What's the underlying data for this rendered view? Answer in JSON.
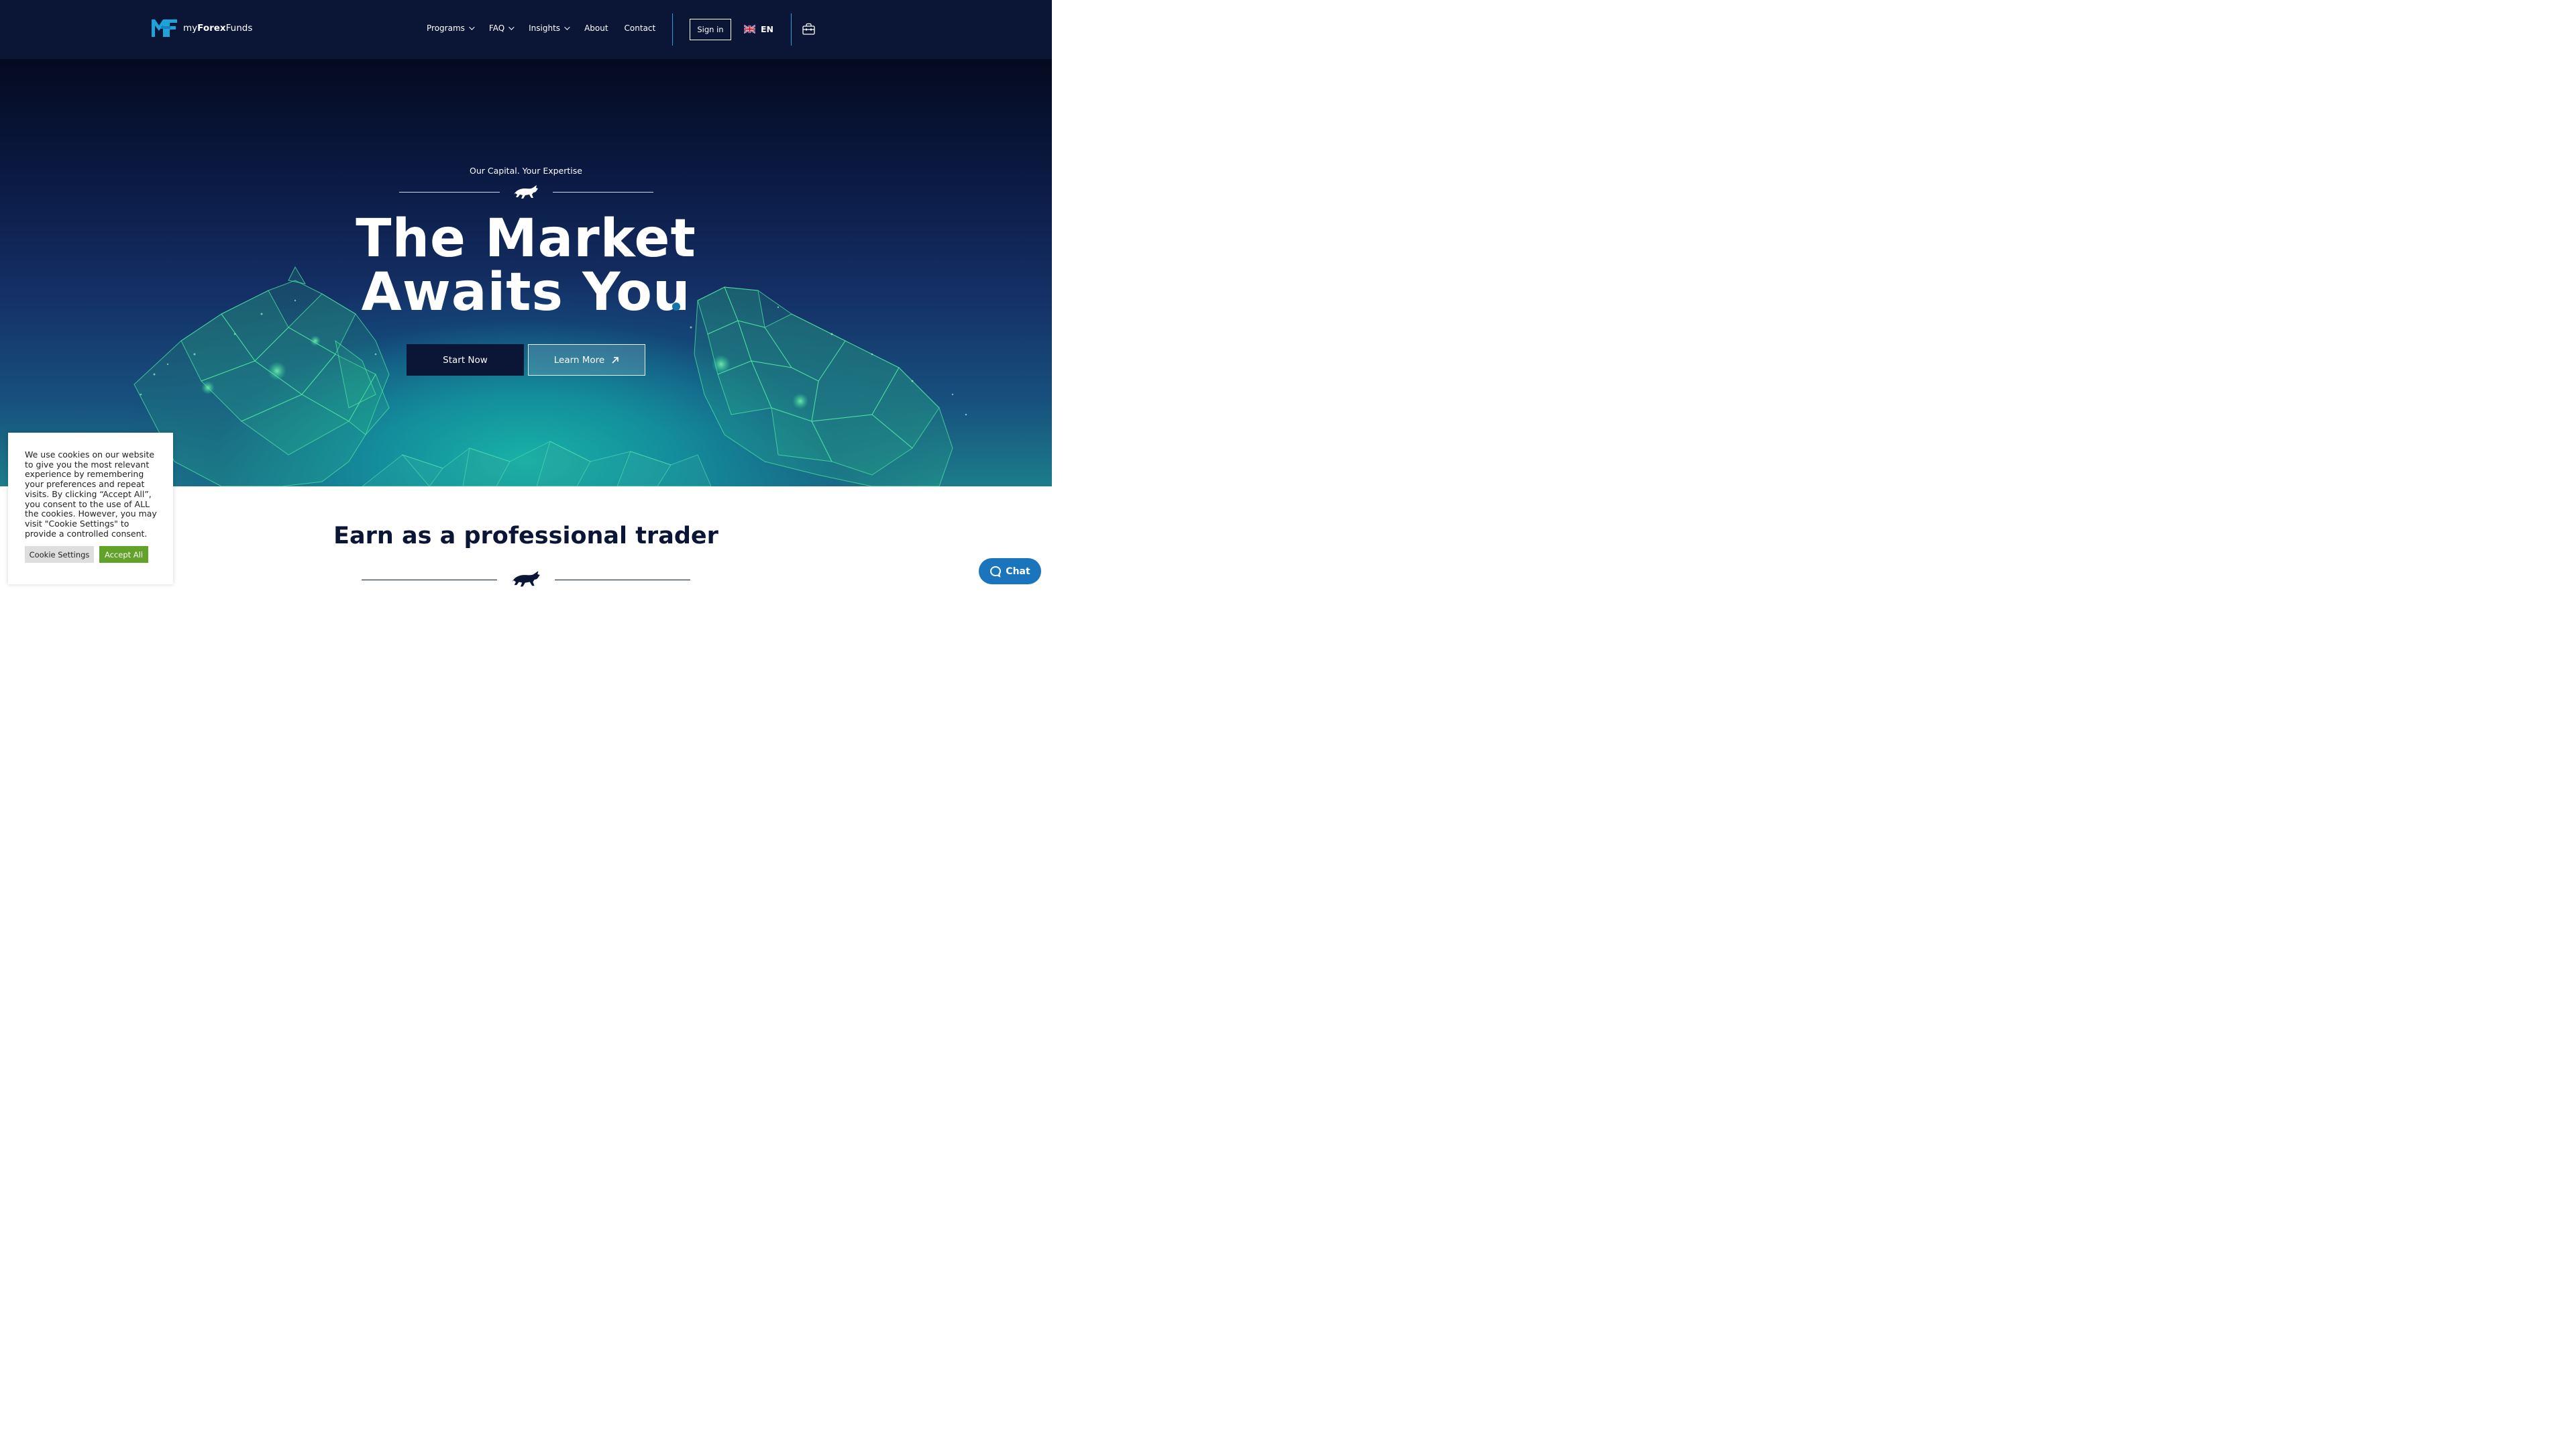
{
  "header": {
    "logo_icon": "mff-logo-icon",
    "logo_text_prefix": "my",
    "logo_text_bold": "Forex",
    "logo_text_suffix": "Funds",
    "nav": [
      {
        "label": "Programs",
        "dropdown": true
      },
      {
        "label": "FAQ",
        "dropdown": true
      },
      {
        "label": "Insights",
        "dropdown": true
      },
      {
        "label": "About",
        "dropdown": false
      },
      {
        "label": "Contact",
        "dropdown": false
      }
    ],
    "signin_label": "Sign in",
    "language": "EN",
    "language_flag": "uk-flag-icon",
    "cart_icon": "shopping-bag-icon",
    "accent_color": "#1ea3d8"
  },
  "hero": {
    "tagline": "Our Capital. Your Expertise",
    "headline_line1": "The Market",
    "headline_line2": "Awaits You",
    "primary_button": "Start Now",
    "secondary_button": "Learn More"
  },
  "section": {
    "title": "Earn as a professional trader"
  },
  "cookie": {
    "text": "We use cookies on our website to give you the most relevant experience by remembering your preferences and repeat visits. By clicking “Accept All”, you consent to the use of ALL the cookies. However, you may visit \"Cookie Settings\" to provide a controlled consent.",
    "settings_label": "Cookie Settings",
    "accept_label": "Accept All",
    "accept_color": "#61a229"
  },
  "chat": {
    "label": "Chat",
    "color": "#1b75bc"
  },
  "colors": {
    "navy": "#0b1637",
    "hero_glow": "#18b2a6"
  }
}
